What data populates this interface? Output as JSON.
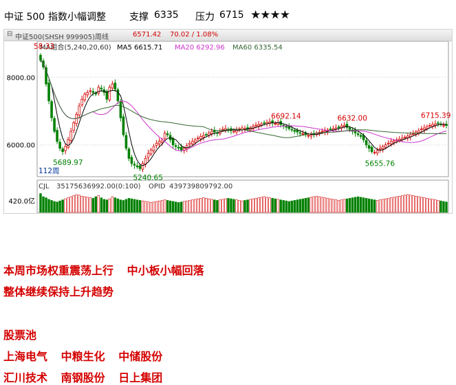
{
  "header": {
    "index_name": "中证 500",
    "title": "指数小幅调整",
    "support_label": "支撑",
    "support_value": "6335",
    "resistance_label": "压力",
    "resistance_value": "6715",
    "rating_stars": 4,
    "rating_text": "★★★★"
  },
  "toolbar": {
    "collapse_icon": "collapse-icon",
    "symbol": "中证500(SHSH 999905)周线",
    "price": "6571.42",
    "change": "70.02 / 1.08%"
  },
  "legend": {
    "ma_group": "MA组合(5,240,20,60)",
    "ma5": "MA5 6615.71",
    "ma20": "MA20 6292.96",
    "ma60": "MA60 6335.54"
  },
  "volume_legend": {
    "cjl": "CJL",
    "cjl_value": "35175636992.00(0:100)",
    "opid": "OPID",
    "opid_value": "439739809792.00"
  },
  "colors": {
    "up": "#d40000",
    "down": "#008000",
    "ma5": "#000000",
    "ma20": "#cc33cc",
    "ma60": "#336633",
    "red_text": "#d40000"
  },
  "chart_data": {
    "type": "candlestick",
    "period_label": "112周",
    "y_ticks": [
      "8000.00",
      "6000.00"
    ],
    "volume_tick": "420.0亿",
    "ylim": [
      5100,
      8900
    ],
    "annotations": [
      {
        "label": "8758.33",
        "shown_text": "58.33",
        "index": 0,
        "value": 8758.33,
        "color": "red"
      },
      {
        "label": "5689.97",
        "index": 7,
        "value": 5689.97,
        "color": "green"
      },
      {
        "label": "5240.65",
        "index": 36,
        "value": 5240.65,
        "color": "green"
      },
      {
        "label": "6692.14",
        "index": 86,
        "value": 6692.14,
        "color": "red"
      },
      {
        "label": "6632.00",
        "index": 110,
        "value": 6632.0,
        "color": "red"
      },
      {
        "label": "5655.76",
        "index": 120,
        "value": 5655.76,
        "color": "green"
      },
      {
        "label": "6715.39",
        "index": 146,
        "value": 6715.39,
        "color": "red"
      }
    ],
    "series_note": "weekly OHLC bars with MA5, MA20, MA60 overlays and volume histogram",
    "closes": [
      8500,
      8300,
      7800,
      7300,
      6800,
      6400,
      6100,
      5900,
      5800,
      5950,
      6150,
      6400,
      6650,
      6900,
      7150,
      7350,
      7500,
      7550,
      7600,
      7550,
      7500,
      7700,
      7650,
      7550,
      7350,
      7700,
      7800,
      7650,
      7300,
      6800,
      6300,
      5900,
      5600,
      5450,
      5400,
      5350,
      5300,
      5450,
      5600,
      5750,
      5850,
      5950,
      6050,
      6100,
      6150,
      6350,
      6300,
      6150,
      6000,
      5950,
      5900,
      5850,
      5900,
      5980,
      6050,
      6100,
      6150,
      6200,
      6250,
      6280,
      6300,
      6350,
      6400,
      6380,
      6350,
      6420,
      6460,
      6480,
      6450,
      6420,
      6400,
      6430,
      6470,
      6500,
      6480,
      6460,
      6500,
      6550,
      6580,
      6600,
      6620,
      6640,
      6660,
      6680,
      6650,
      6630,
      6660,
      6600,
      6560,
      6520,
      6480,
      6450,
      6400,
      6380,
      6350,
      6330,
      6300,
      6280,
      6300,
      6320,
      6350,
      6370,
      6400,
      6420,
      6440,
      6460,
      6480,
      6500,
      6520,
      6560,
      6580,
      6520,
      6460,
      6400,
      6350,
      6300,
      6250,
      6150,
      6000,
      5900,
      5800,
      5780,
      5830,
      5900,
      5950,
      6000,
      6050,
      6100,
      6120,
      6150,
      6170,
      6200,
      6230,
      6260,
      6300,
      6330,
      6380,
      6420,
      6470,
      6500,
      6540,
      6570,
      6600,
      6620,
      6640,
      6600,
      6580,
      6571.42
    ],
    "volumes": [
      360,
      300,
      280,
      250,
      230,
      210,
      200,
      220,
      240,
      260,
      280,
      300,
      320,
      340,
      330,
      310,
      300,
      290,
      280,
      270,
      300,
      320,
      280,
      250,
      240,
      260,
      300,
      280,
      260,
      240,
      230,
      250,
      270,
      260,
      250,
      240,
      230,
      220,
      210,
      200,
      190,
      200,
      210,
      220,
      230,
      240,
      230,
      220,
      210,
      200,
      190,
      200,
      210,
      220,
      230,
      240,
      250,
      260,
      270,
      280,
      270,
      260,
      250,
      240,
      230,
      240,
      250,
      260,
      270,
      260,
      250,
      240,
      230,
      220,
      230,
      240,
      250,
      260,
      270,
      280,
      290,
      300,
      290,
      280,
      270,
      260,
      250,
      240,
      230,
      220,
      210,
      220,
      230,
      240,
      250,
      260,
      270,
      280,
      290,
      300,
      310,
      300,
      290,
      280,
      270,
      260,
      250,
      240,
      230,
      240,
      250,
      260,
      270,
      280,
      290,
      300,
      290,
      280,
      270,
      260,
      250,
      240,
      230,
      240,
      250,
      260,
      270,
      280,
      290,
      300,
      310,
      320,
      330,
      340,
      330,
      320,
      310,
      300,
      290,
      280,
      270,
      260,
      250,
      240,
      230,
      220,
      210,
      200
    ]
  },
  "notes": {
    "line1": [
      "本周市场权重震荡上行",
      "中小板小幅回落"
    ],
    "line2": "整体继续保持上升趋势",
    "pool_title": "股票池",
    "pool_row1": [
      "上海电气",
      "中粮生化",
      "中储股份"
    ],
    "pool_row2": [
      "汇川技术",
      "南钢股份",
      "日上集团"
    ]
  }
}
